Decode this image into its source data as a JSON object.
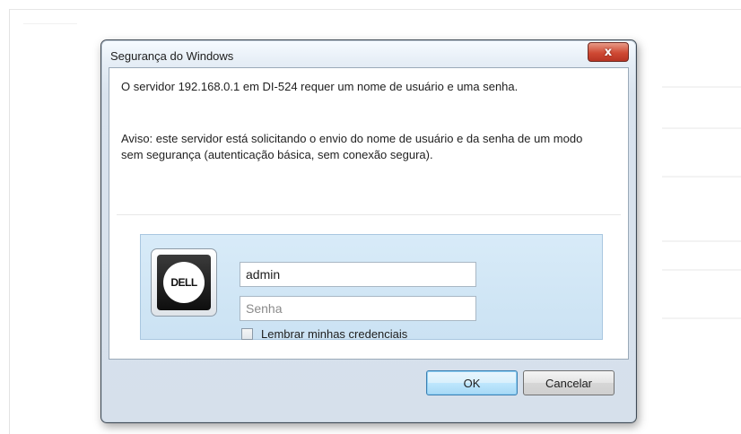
{
  "window": {
    "title": "Segurança do Windows",
    "close_label": "x"
  },
  "message": {
    "line1": "O servidor 192.168.0.1 em DI-524 requer um nome de usuário e uma senha.",
    "warning": "Aviso: este servidor está solicitando o envio do nome de usuário e da senha de um modo sem segurança (autenticação básica, sem conexão segura)."
  },
  "credentials": {
    "logo_text": "DELL",
    "username_value": "admin",
    "password_placeholder": "Senha",
    "remember_label": "Lembrar minhas credenciais",
    "remember_checked": false
  },
  "buttons": {
    "ok_label": "OK",
    "cancel_label": "Cancelar"
  },
  "colors": {
    "accent": "#3c7fb1",
    "close_button": "#cf4a34",
    "credential_panel": "#d8ebf8"
  }
}
